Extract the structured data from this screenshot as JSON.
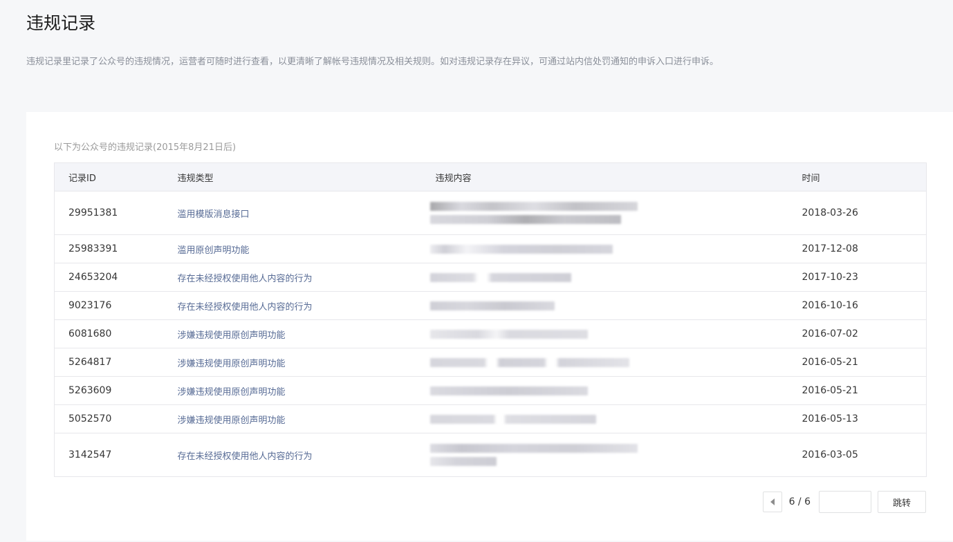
{
  "page": {
    "title": "违规记录",
    "description": "违规记录里记录了公众号的违规情况，运营者可随时进行查看，以更清晰了解帐号违规情况及相关规则。如对违规记录存在异议，可通过站内信处罚通知的申诉入口进行申诉。"
  },
  "table": {
    "caption": "以下为公众号的违规记录(2015年8月21日后)",
    "headers": {
      "id": "记录ID",
      "type": "违规类型",
      "content": "违规内容",
      "time": "时间"
    },
    "rows": [
      {
        "id": "29951381",
        "type": "滥用模版消息接口",
        "time": "2018-03-26"
      },
      {
        "id": "25983391",
        "type": "滥用原创声明功能",
        "time": "2017-12-08"
      },
      {
        "id": "24653204",
        "type": "存在未经授权使用他人内容的行为",
        "time": "2017-10-23"
      },
      {
        "id": "9023176",
        "type": "存在未经授权使用他人内容的行为",
        "time": "2016-10-16"
      },
      {
        "id": "6081680",
        "type": "涉嫌违规使用原创声明功能",
        "time": "2016-07-02"
      },
      {
        "id": "5264817",
        "type": "涉嫌违规使用原创声明功能",
        "time": "2016-05-21"
      },
      {
        "id": "5263609",
        "type": "涉嫌违规使用原创声明功能",
        "time": "2016-05-21"
      },
      {
        "id": "5052570",
        "type": "涉嫌违规使用原创声明功能",
        "time": "2016-05-13"
      },
      {
        "id": "3142547",
        "type": "存在未经授权使用他人内容的行为",
        "time": "2016-03-05"
      }
    ]
  },
  "pager": {
    "count": "6 / 6",
    "input_value": "",
    "jump_label": "跳转"
  },
  "colors": {
    "link": "#576b95",
    "border": "#e7e7eb",
    "header_bg": "#f4f5f9",
    "page_bg": "#f6f7f9"
  }
}
